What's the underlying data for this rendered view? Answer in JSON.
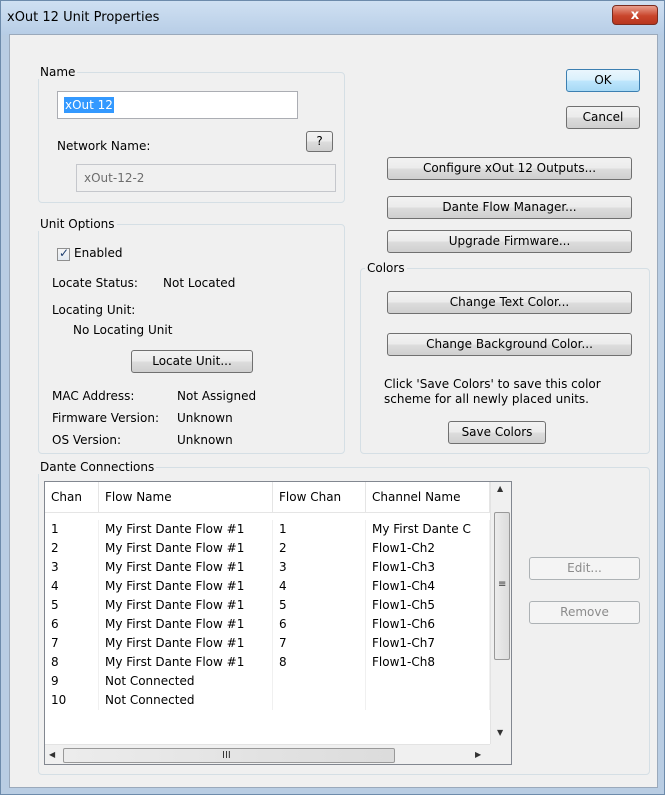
{
  "window": {
    "title": "xOut 12 Unit Properties",
    "close_glyph": "x"
  },
  "name_group": {
    "label": "Name",
    "name_value": "xOut 12",
    "network_name_label": "Network Name:",
    "help_label": "?",
    "network_name_value": "xOut-12-2"
  },
  "buttons": {
    "ok": "OK",
    "cancel": "Cancel",
    "configure": "Configure xOut 12 Outputs...",
    "dante_flow": "Dante Flow Manager...",
    "firmware": "Upgrade Firmware...",
    "change_text": "Change Text Color...",
    "change_bg": "Change Background Color...",
    "save_colors": "Save Colors",
    "locate": "Locate Unit...",
    "edit": "Edit...",
    "remove": "Remove"
  },
  "unit_options": {
    "label": "Unit Options",
    "enabled_label": "Enabled",
    "enabled_checked": true,
    "locate_status_label": "Locate Status:",
    "locate_status_value": "Not Located",
    "locating_unit_label": "Locating Unit:",
    "locating_unit_value": "No Locating Unit",
    "mac_label": "MAC Address:",
    "mac_value": "Not Assigned",
    "firmware_label": "Firmware Version:",
    "firmware_value": "Unknown",
    "os_label": "OS Version:",
    "os_value": "Unknown"
  },
  "colors": {
    "label": "Colors",
    "info_line1": "Click 'Save Colors' to save this color",
    "info_line2": "scheme for all newly placed units."
  },
  "dante": {
    "label": "Dante Connections",
    "columns": [
      "Chan",
      "Flow Name",
      "Flow Chan",
      "Channel Name"
    ],
    "rows": [
      [
        "1",
        "My First Dante Flow #1",
        "1",
        "My First Dante C"
      ],
      [
        "2",
        "My First Dante Flow #1",
        "2",
        "Flow1-Ch2"
      ],
      [
        "3",
        "My First Dante Flow #1",
        "3",
        "Flow1-Ch3"
      ],
      [
        "4",
        "My First Dante Flow #1",
        "4",
        "Flow1-Ch4"
      ],
      [
        "5",
        "My First Dante Flow #1",
        "5",
        "Flow1-Ch5"
      ],
      [
        "6",
        "My First Dante Flow #1",
        "6",
        "Flow1-Ch6"
      ],
      [
        "7",
        "My First Dante Flow #1",
        "7",
        "Flow1-Ch7"
      ],
      [
        "8",
        "My First Dante Flow #1",
        "8",
        "Flow1-Ch8"
      ],
      [
        "9",
        "Not Connected",
        "",
        ""
      ],
      [
        "10",
        "Not Connected",
        "",
        ""
      ]
    ],
    "hscroll_grip": "III",
    "vscroll_grip": "≡"
  }
}
